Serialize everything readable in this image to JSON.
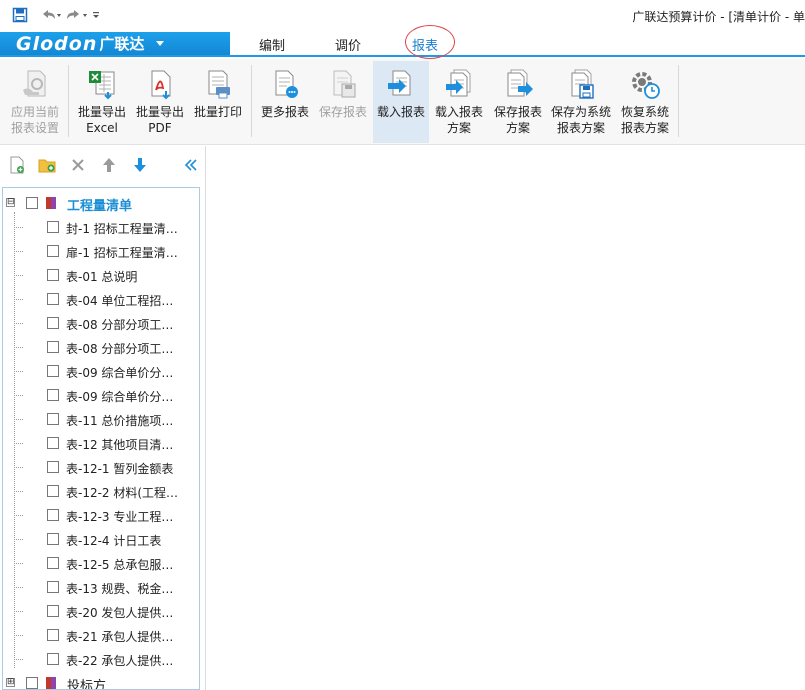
{
  "titlebar": {
    "title": "广联达预算计价 - [清单计价 - 单",
    "qat": [
      {
        "icon": "save-icon"
      },
      {
        "icon": "undo-icon"
      },
      {
        "icon": "redo-icon"
      },
      {
        "icon": "customize-qat-icon"
      }
    ]
  },
  "brand": {
    "logo": "Glodon",
    "name": "广联达"
  },
  "tabs": [
    {
      "label": "编制"
    },
    {
      "label": "调价"
    },
    {
      "label": "报表",
      "active": true
    }
  ],
  "colors": {
    "accent": "#1e9be6",
    "highlight_circle": "#e0454a",
    "active_tab_text": "#1e7fd0",
    "tree_root_text": "#1b8fd6"
  },
  "ribbon": {
    "buttons": [
      {
        "line1": "应用当前",
        "line2": "报表设置",
        "icon": "apply-settings-icon",
        "disabled": true
      },
      {
        "line1": "批量导出",
        "line2": "Excel",
        "icon": "excel-export-icon"
      },
      {
        "line1": "批量导出",
        "line2": "PDF",
        "icon": "pdf-export-icon"
      },
      {
        "line1": "批量打印",
        "line2": "",
        "icon": "print-icon"
      },
      {
        "line1": "更多报表",
        "line2": "",
        "icon": "more-reports-icon"
      },
      {
        "line1": "保存报表",
        "line2": "",
        "icon": "save-report-icon",
        "disabled": true
      },
      {
        "line1": "载入报表",
        "line2": "",
        "icon": "load-report-icon",
        "active": true
      },
      {
        "line1": "载入报表",
        "line2": "方案",
        "icon": "load-scheme-icon"
      },
      {
        "line1": "保存报表",
        "line2": "方案",
        "icon": "save-scheme-icon"
      },
      {
        "line1": "保存为系统",
        "line2": "报表方案",
        "icon": "save-system-scheme-icon"
      },
      {
        "line1": "恢复系统",
        "line2": "报表方案",
        "icon": "restore-system-scheme-icon"
      }
    ]
  },
  "panel": {
    "toolbar": [
      {
        "icon": "new-report-icon"
      },
      {
        "icon": "new-folder-icon"
      },
      {
        "icon": "delete-icon"
      },
      {
        "icon": "move-up-icon"
      },
      {
        "icon": "move-down-icon"
      },
      {
        "icon": "collapse-panel-icon"
      }
    ],
    "tree": {
      "root": {
        "label": "工程量清单",
        "expander": "⊟"
      },
      "items": [
        "封-1 招标工程量清…",
        "扉-1 招标工程量清…",
        "表-01 总说明",
        "表-04 单位工程招…",
        "表-08 分部分项工…",
        "表-08 分部分项工…",
        "表-09 综合单价分…",
        "表-09 综合单价分…",
        "表-11 总价措施项…",
        "表-12 其他项目清…",
        "表-12-1 暂列金额表",
        "表-12-2 材料(工程…",
        "表-12-3 专业工程…",
        "表-12-4 计日工表",
        "表-12-5 总承包服…",
        "表-13 规费、税金…",
        "表-20 发包人提供…",
        "表-21 承包人提供…",
        "表-22 承包人提供…"
      ],
      "root2": {
        "label": "投标方",
        "expander": "⊞"
      }
    }
  }
}
